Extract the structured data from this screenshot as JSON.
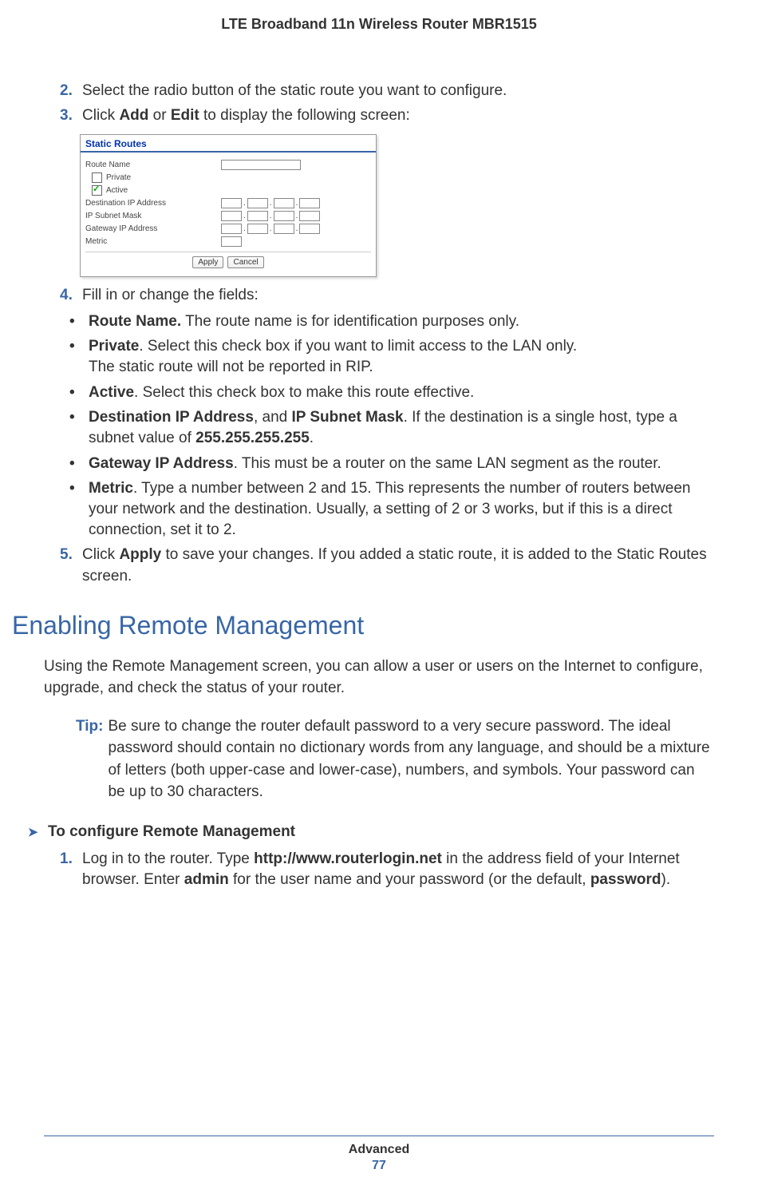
{
  "header": {
    "title": "LTE Broadband 11n Wireless Router MBR1515"
  },
  "steps_a": {
    "s2": {
      "num": "2.",
      "text": "Select the radio button of the static route you want to configure."
    },
    "s3": {
      "num": "3.",
      "prefix": "Click ",
      "b1": "Add",
      "mid": " or ",
      "b2": "Edit",
      "suffix": " to display the following screen:"
    }
  },
  "screenshot": {
    "title": "Static Routes",
    "route_name": "Route Name",
    "private": "Private",
    "active": "Active",
    "dest": "Destination IP Address",
    "subnet": "IP Subnet Mask",
    "gateway": "Gateway IP Address",
    "metric": "Metric",
    "apply": "Apply",
    "cancel": "Cancel"
  },
  "step4": {
    "num": "4.",
    "text": "Fill in or change the fields:"
  },
  "bullets": {
    "b1": {
      "bold": "Route Name.",
      "text": " The route name is for identification purposes only."
    },
    "b2": {
      "bold": "Private",
      "text1": ". Select this check box if you want to limit access to the LAN only.",
      "text2": "The static route will not be reported in RIP."
    },
    "b3": {
      "bold": "Active",
      "text": ". Select this check box to make this route effective."
    },
    "b4": {
      "bold1": "Destination IP Address",
      "mid": ", and ",
      "bold2": "IP Subnet Mask",
      "text1": ". If the destination is a single host, type a subnet value of ",
      "bold3": "255.255.255.255",
      "text2": "."
    },
    "b5": {
      "bold": "Gateway IP Address",
      "text": ". This must be a router on the same LAN segment as the router."
    },
    "b6": {
      "bold": "Metric",
      "text": ". Type a number between 2 and 15. This represents the number of routers between your network and the destination. Usually, a setting of 2 or 3 works, but if this is a direct connection, set it to 2."
    }
  },
  "step5": {
    "num": "5.",
    "prefix": "Click ",
    "bold": "Apply",
    "text": " to save your changes. If you added a static route, it is added to the Static Routes screen."
  },
  "section2": {
    "heading": "Enabling Remote Management",
    "intro": "Using the Remote Management screen, you can allow a user or users on the Internet to configure, upgrade, and check the status of your router.",
    "tip_label": "Tip:",
    "tip": "Be sure to change the router default password to a very secure password. The ideal password should contain no dictionary words from any language, and should be a mixture of letters (both upper-case and lower-case), numbers, and symbols. Your password can be up to 30 characters.",
    "proc": "To configure Remote Management",
    "s1": {
      "num": "1.",
      "t1": "Log in to the router. Type ",
      "b1": "http://www.routerlogin.net",
      "t2": " in the address field of your Internet browser. Enter ",
      "b2": "admin",
      "t3": " for the user name and your password (or the default, ",
      "b3": "password",
      "t4": ")."
    }
  },
  "footer": {
    "section": "Advanced",
    "page": "77"
  }
}
